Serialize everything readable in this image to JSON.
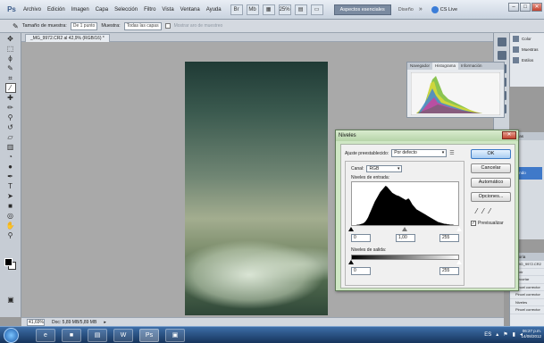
{
  "app": {
    "logo": "Ps",
    "menu": [
      "Archivo",
      "Edición",
      "Imagen",
      "Capa",
      "Selección",
      "Filtro",
      "Vista",
      "Ventana",
      "Ayuda"
    ],
    "zoom_label": "25%",
    "workspace": "Aspectos esenciales",
    "workspace_alt": "Diseño",
    "more": "»",
    "cslive": "CS Live"
  },
  "options": {
    "sample_size_label": "Tamaño de muestra:",
    "sample_size_value": "De 1 punto",
    "sample_label": "Muestra:",
    "sample_value": "Todas las capas",
    "show_ring": "Mostrar aro de muestreo"
  },
  "document": {
    "tab_label": "_MG_9972.CR2 al 42,9% (RGB/16) *"
  },
  "status": {
    "zoom": "41,69%",
    "doc": "Doc: 5,89 MB/5,89 MB"
  },
  "histogram_panel": {
    "tabs": [
      "Navegador",
      "Histograma",
      "Información"
    ]
  },
  "right_panels": {
    "color": "Color",
    "swatches": "Muestras",
    "styles": "Estilos",
    "layers_hdr": "Capas",
    "layer_name": "Fondo"
  },
  "history": {
    "header": "Historia",
    "items": [
      "_MG_9972.CR2",
      "Abrir",
      "Recortar",
      "Pincel corrector",
      "Pincel corrector",
      "Niveles",
      "Pincel corrector"
    ]
  },
  "levels": {
    "title": "Niveles",
    "close": "✕",
    "preset_label": "Ajuste preestablecido:",
    "preset_value": "Por defecto",
    "preset_menu": "☰",
    "channel_label": "Canal:",
    "channel_value": "RGB",
    "input_label": "Niveles de entrada:",
    "input_black": "0",
    "input_gamma": "1,00",
    "input_white": "255",
    "output_label": "Niveles de salida:",
    "output_black": "0",
    "output_white": "255",
    "buttons": {
      "ok": "OK",
      "cancel": "Cancelar",
      "auto": "Automático",
      "options": "Opciones..."
    },
    "preview_label": "Previsualizar",
    "preview_checked": "✓",
    "histogram": [
      0,
      0,
      0,
      0,
      1,
      1,
      2,
      3,
      4,
      6,
      9,
      14,
      20,
      28,
      36,
      44,
      52,
      60,
      66,
      72,
      78,
      84,
      88,
      92,
      96,
      100,
      98,
      94,
      90,
      86,
      82,
      80,
      78,
      76,
      75,
      74,
      72,
      70,
      68,
      66,
      64,
      66,
      68,
      64,
      58,
      52,
      48,
      44,
      40,
      38,
      36,
      34,
      32,
      30,
      28,
      26,
      24,
      22,
      20,
      18,
      16,
      14,
      12,
      10,
      8,
      7,
      6,
      5,
      4,
      3,
      3,
      2,
      2,
      1,
      1,
      1,
      0,
      0,
      0,
      0
    ]
  },
  "taskbar": {
    "items": [
      "e",
      "■",
      "▤",
      "W",
      "Ps",
      "▣"
    ],
    "tray": "ES",
    "time": "06:27 p.m.",
    "date": "14/08/2012"
  }
}
